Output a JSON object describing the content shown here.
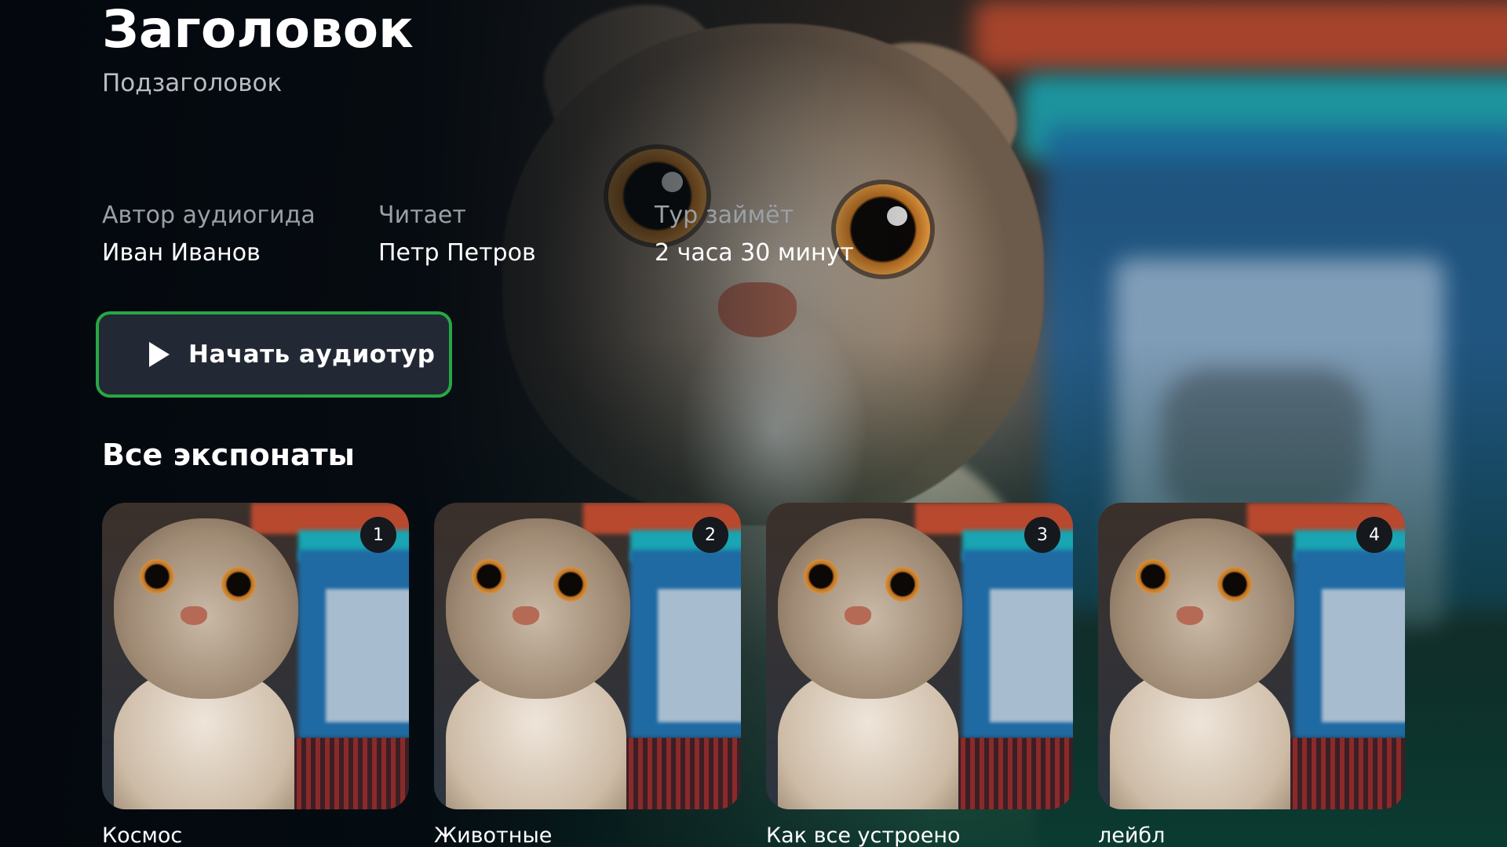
{
  "hero": {
    "title": "Заголовок",
    "subtitle": "Подзаголовок"
  },
  "meta": [
    {
      "label": "Автор аудиогида",
      "value": "Иван Иванов"
    },
    {
      "label": "Читает",
      "value": "Петр Петров"
    },
    {
      "label": "Тур займёт",
      "value": "2 часа 30 минут"
    }
  ],
  "start_button": {
    "label": "Начать аудиотур",
    "icon": "play-icon",
    "border_color": "#28a745"
  },
  "exhibits": {
    "section_title": "Все экспонаты",
    "items": [
      {
        "number": "1",
        "title": "Космос"
      },
      {
        "number": "2",
        "title": "Животные"
      },
      {
        "number": "3",
        "title": "Как все устроено"
      },
      {
        "number": "4",
        "title": "лейбл"
      }
    ]
  },
  "colors": {
    "background_dark": "#04080e",
    "background_green": "#0a3c30",
    "button_background": "#232934",
    "muted_text": "#9aa0a6"
  }
}
